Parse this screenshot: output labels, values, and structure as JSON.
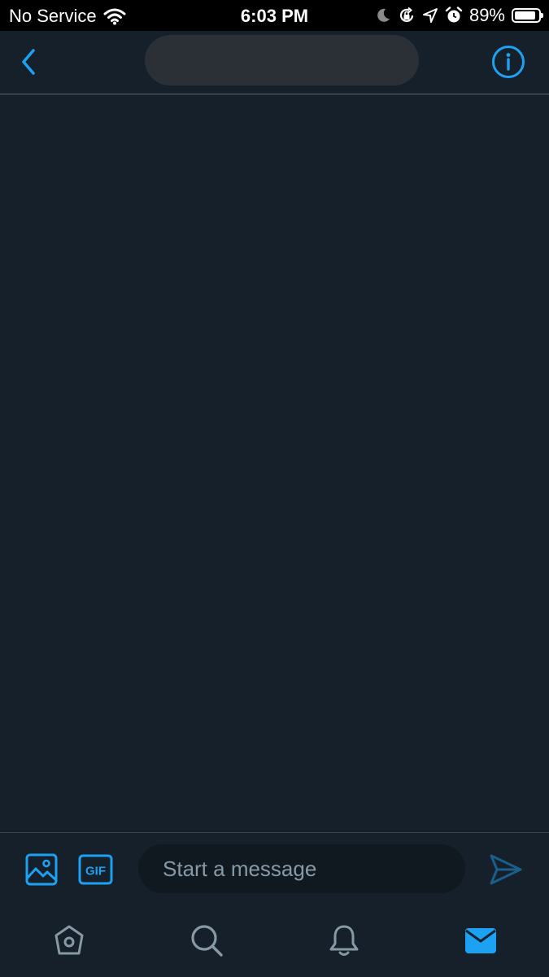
{
  "status_bar": {
    "carrier": "No Service",
    "time": "6:03 PM",
    "battery_percent": "89%",
    "battery_level": 0.89,
    "icons": [
      "wifi-icon",
      "moon-icon",
      "rotation-lock-icon",
      "location-arrow-icon",
      "alarm-icon",
      "battery-icon"
    ]
  },
  "header": {
    "back_icon": "chevron-left-icon",
    "info_icon": "info-circle-icon",
    "title_redacted": true
  },
  "composer": {
    "placeholder": "Start a message",
    "media_icon": "image-icon",
    "gif_label": "GIF",
    "send_icon": "send-icon"
  },
  "tab_bar": {
    "tabs": [
      {
        "icon": "home-icon",
        "active": false
      },
      {
        "icon": "search-icon",
        "active": false
      },
      {
        "icon": "bell-icon",
        "active": false
      },
      {
        "icon": "mail-icon",
        "active": true
      }
    ]
  },
  "colors": {
    "background": "#15202b",
    "accent": "#1da1f2",
    "muted_icon": "#8899a6",
    "input_background": "#101820",
    "divider": "#38444d"
  }
}
